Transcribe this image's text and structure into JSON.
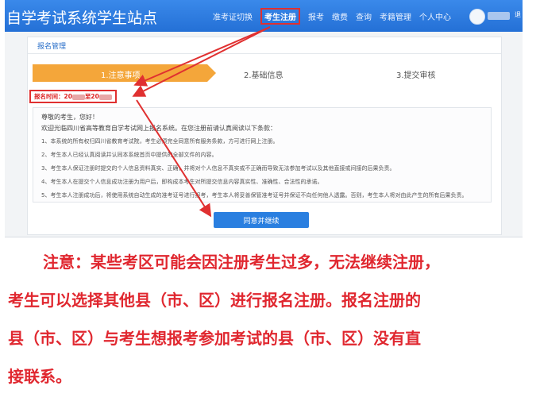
{
  "site_title": "自学考试系统学生站点",
  "nav": {
    "items": [
      "准考证切换",
      "考生注册",
      "报考",
      "缴费",
      "查询",
      "考籍管理",
      "个人中心"
    ],
    "active_index": 1
  },
  "user": {
    "extra": "退"
  },
  "panel": {
    "title": "报名管理",
    "steps": [
      "1.注意事项",
      "2.基础信息",
      "3.提交审核"
    ],
    "current_step": 1,
    "reg_time_prefix": "报名时间：20",
    "reg_time_mid": "至20",
    "notice": {
      "greeting": "尊敬的考生，您好！",
      "welcome": "欢迎光临四川省高等教育自学考试网上报名系统。在您注册前请认真阅读以下条款：",
      "items": [
        "1、本系统的所有权归四川省教育考试院，考生必须完全同意所有服务条款，方可进行网上注册。",
        "2、考生本人已经认真阅读并认同本系统首页中提供的全部文件的内容。",
        "3、考生本人保证注册时提交的个人信息资料真实、正确，并将对个人信息不真实或不正确而导致无法参加考试以及其他直接或间接的后果负责。",
        "4、考生本人在提交个人信息成功注册为用户后，即构成本考生对所提交信息内容真实性、准确性、合法性的承诺。",
        "5、考生本人注册成功后，将使用系统自动生成的准考证号进行报考，考生本人将妥善保管准考证号并保证不向任何他人透露。否则，考生本人将对由此产生的所有后果负责。"
      ]
    },
    "agree_button": "同意并继续"
  },
  "caption": {
    "lines": [
      "注意：某些考区可能会因注册考生过多，无法继续注册，",
      "考生可以选择其他县（市、区）进行报名注册。报名注册的",
      "县（市、区）与考生想报考参加考试的县（市、区）没有直",
      "接联系。"
    ]
  },
  "colors": {
    "topbar": "#2c7be0",
    "step_active": "#f4a63a",
    "highlight_red": "#e03030",
    "caption_red": "#e0272f",
    "button_blue": "#2a7fe0"
  }
}
